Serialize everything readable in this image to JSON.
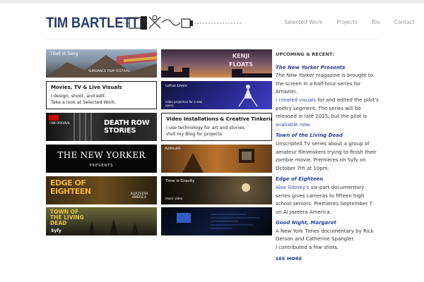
{
  "header": {
    "logo_text": "TIM BARTLETT",
    "nav": [
      "Selected Work",
      "Projects",
      "Bio",
      "Contact"
    ]
  },
  "tiles": {
    "tibet": {
      "caption": "Tibet in Song",
      "badge": "SUNDANCE FILM FESTIVAL"
    },
    "movies": {
      "heading": "Movies, TV & Live Visuals",
      "line1": "I design, shoot, and edit.",
      "line2": "Take a look at Selected Work."
    },
    "kenji": {
      "caption": "KENJI FLOATS"
    },
    "lotus": {
      "caption": "Lotus Lives",
      "sub": "video projection for a new opera"
    },
    "video": {
      "heading": "Video Installations & Creative Tinkering",
      "line1": "I use technology for art and stories.",
      "line2": "Visit my Blog for projects."
    },
    "deathrow": {
      "network": "CNN ORIGINAL",
      "title": "DEATH ROW STORIES"
    },
    "newyorker": {
      "title": "THE NEW YORKER",
      "sub": "PRESENTS"
    },
    "azimuth": {
      "caption": "Azimuth"
    },
    "edge": {
      "title": "EDGE OF EIGHTEEN",
      "network": "ALJAZEERA AMERICA"
    },
    "timegravity": {
      "caption": "Time is Gravity",
      "sub": "music video"
    },
    "town": {
      "title": "TOWN OF THE LIVING DEAD",
      "network": "Syfy"
    }
  },
  "sidebar": {
    "heading": "UPCOMING & RECENT:",
    "items": [
      {
        "title": "The New Yorker Presents",
        "p1_em": "The New Yorker",
        "p1": " magazine is brought to the screen in a half-hour series for Amazon.",
        "link1": "I created visuals",
        "p2": " for and edited the pilot's poetry segment. The series will be released in late 2015, but the pilot is ",
        "link2": "available now",
        "p2_end": "."
      },
      {
        "title": "Town of the Living Dead",
        "p1": "Unscripted TV series about a group of amateur filmmakers trying to finish their zombie movie. Premieres on Syfy on October 7th at 10pm."
      },
      {
        "title": "Edge of Eighteen",
        "link1": "Alex Gibney's",
        "p1": " six-part documentary series gives cameras to fifteen high school seniors. Premieres September 7 on Al Jazeera America."
      },
      {
        "title": "Good Night, Margaret",
        "p1": "A New York Times documentary by Rick Gerson and Catherine Spangler.",
        "p2": "I contributed a few shots."
      }
    ],
    "more": "SEE MORE"
  },
  "colors": {
    "accent": "#2a3d9b",
    "logo": "#2a3d6b",
    "nav": "#999999"
  }
}
